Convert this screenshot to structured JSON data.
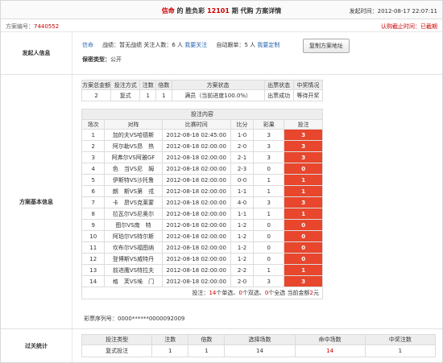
{
  "header": {
    "title_pre1": "信命",
    "title_pre2": " 的 胜负彩 ",
    "title_period": "12101",
    "title_post": " 期 代购 方案详情",
    "initiate_label": "发起时间：",
    "initiate_time": "2012-08-17 22:07:11"
  },
  "idrow": {
    "label": "方案编号：",
    "number": "7440552",
    "deadline": "认购截止时间：已截期"
  },
  "initiator": {
    "section_label": "发起人信息",
    "name": "信命",
    "record_label": "战绩：暂无战绩",
    "follow_label": "关注人数：",
    "follow_count": "6",
    "follow_unit": " 人 ",
    "follow_link": "我要关注",
    "auto_label": "自动跟单：",
    "auto_count": "5",
    "auto_unit": " 人 ",
    "auto_link": "我要定制",
    "copy_button": "复制方案地址",
    "privacy_label": "保密类型：",
    "privacy_value": "公开"
  },
  "basic": {
    "section_label": "方案基本信息",
    "summary_headers": [
      "方案总金额",
      "投注方式",
      "注数",
      "倍数",
      "方案状态",
      "出票状态",
      "中奖情况"
    ],
    "summary_values": [
      "2",
      "复式",
      "1",
      "1",
      "满员（当前进度100.0%）",
      "出票成功",
      "等待开奖"
    ],
    "content_header": "投注内容",
    "match_headers": [
      "场次",
      "对阵",
      "比赛时间",
      "比分",
      "彩果",
      "投注"
    ],
    "matches": [
      [
        "1",
        "加的夫VS哈德斯",
        "2012-08-18 02:45:00",
        "1-0",
        "3",
        "3"
      ],
      [
        "2",
        "阿尔勒VS昂　热",
        "2012-08-18 02:00:00",
        "2-0",
        "3",
        "3"
      ],
      [
        "3",
        "阿弗尔VS阿雅GF",
        "2012-08-18 02:00:00",
        "2-1",
        "3",
        "3"
      ],
      [
        "4",
        "色　当VS尼　姆",
        "2012-08-18 02:00:00",
        "2-3",
        "0",
        "0"
      ],
      [
        "5",
        "伊斯特VS沙托鲁",
        "2012-08-18 02:00:00",
        "0-0",
        "1",
        "1"
      ],
      [
        "6",
        "朗　斯VS第　戎",
        "2012-08-18 02:00:00",
        "1-1",
        "1",
        "1"
      ],
      [
        "7",
        "卡　昂VS克莱蒙",
        "2012-08-18 02:00:00",
        "4-0",
        "3",
        "3"
      ],
      [
        "8",
        "拉瓦尔VS尼奥尔",
        "2012-08-18 02:00:00",
        "1-1",
        "1",
        "1"
      ],
      [
        "9",
        "图尔VS南　特",
        "2012-08-18 02:00:00",
        "1-2",
        "0",
        "0"
      ],
      [
        "10",
        "阿珀尔VS特尔斯",
        "2012-08-18 02:00:00",
        "1-2",
        "0",
        "0"
      ],
      [
        "11",
        "坎布尔VS福图纳",
        "2012-08-18 02:00:00",
        "1-2",
        "0",
        "0"
      ],
      [
        "12",
        "登博斯VS威特丹",
        "2012-08-18 02:00:00",
        "1-2",
        "0",
        "0"
      ],
      [
        "13",
        "前进鹰VS特拉夫",
        "2012-08-18 02:00:00",
        "2-2",
        "1",
        "1"
      ],
      [
        "14",
        "格　芙VS埃　门",
        "2012-08-18 02:00:00",
        "2-0",
        "3",
        "3"
      ]
    ],
    "total_pre": "投注：",
    "total_single": "14",
    "total_mid1": "个单选、",
    "total_double": "0",
    "total_mid2": "个双选、",
    "total_full": "0",
    "total_mid3": "个全选 当前金额",
    "total_amount": "2",
    "total_unit": "元",
    "serial_label": "彩票序列号：",
    "serial_value": "0000******0000092009"
  },
  "pass": {
    "section_label": "过关统计",
    "headers": [
      "投注类型",
      "注数",
      "倍数",
      "选择场数",
      "命中场数",
      "中奖注数"
    ],
    "values": [
      "复式投注",
      "1",
      "1",
      "14",
      "14",
      "1"
    ]
  }
}
